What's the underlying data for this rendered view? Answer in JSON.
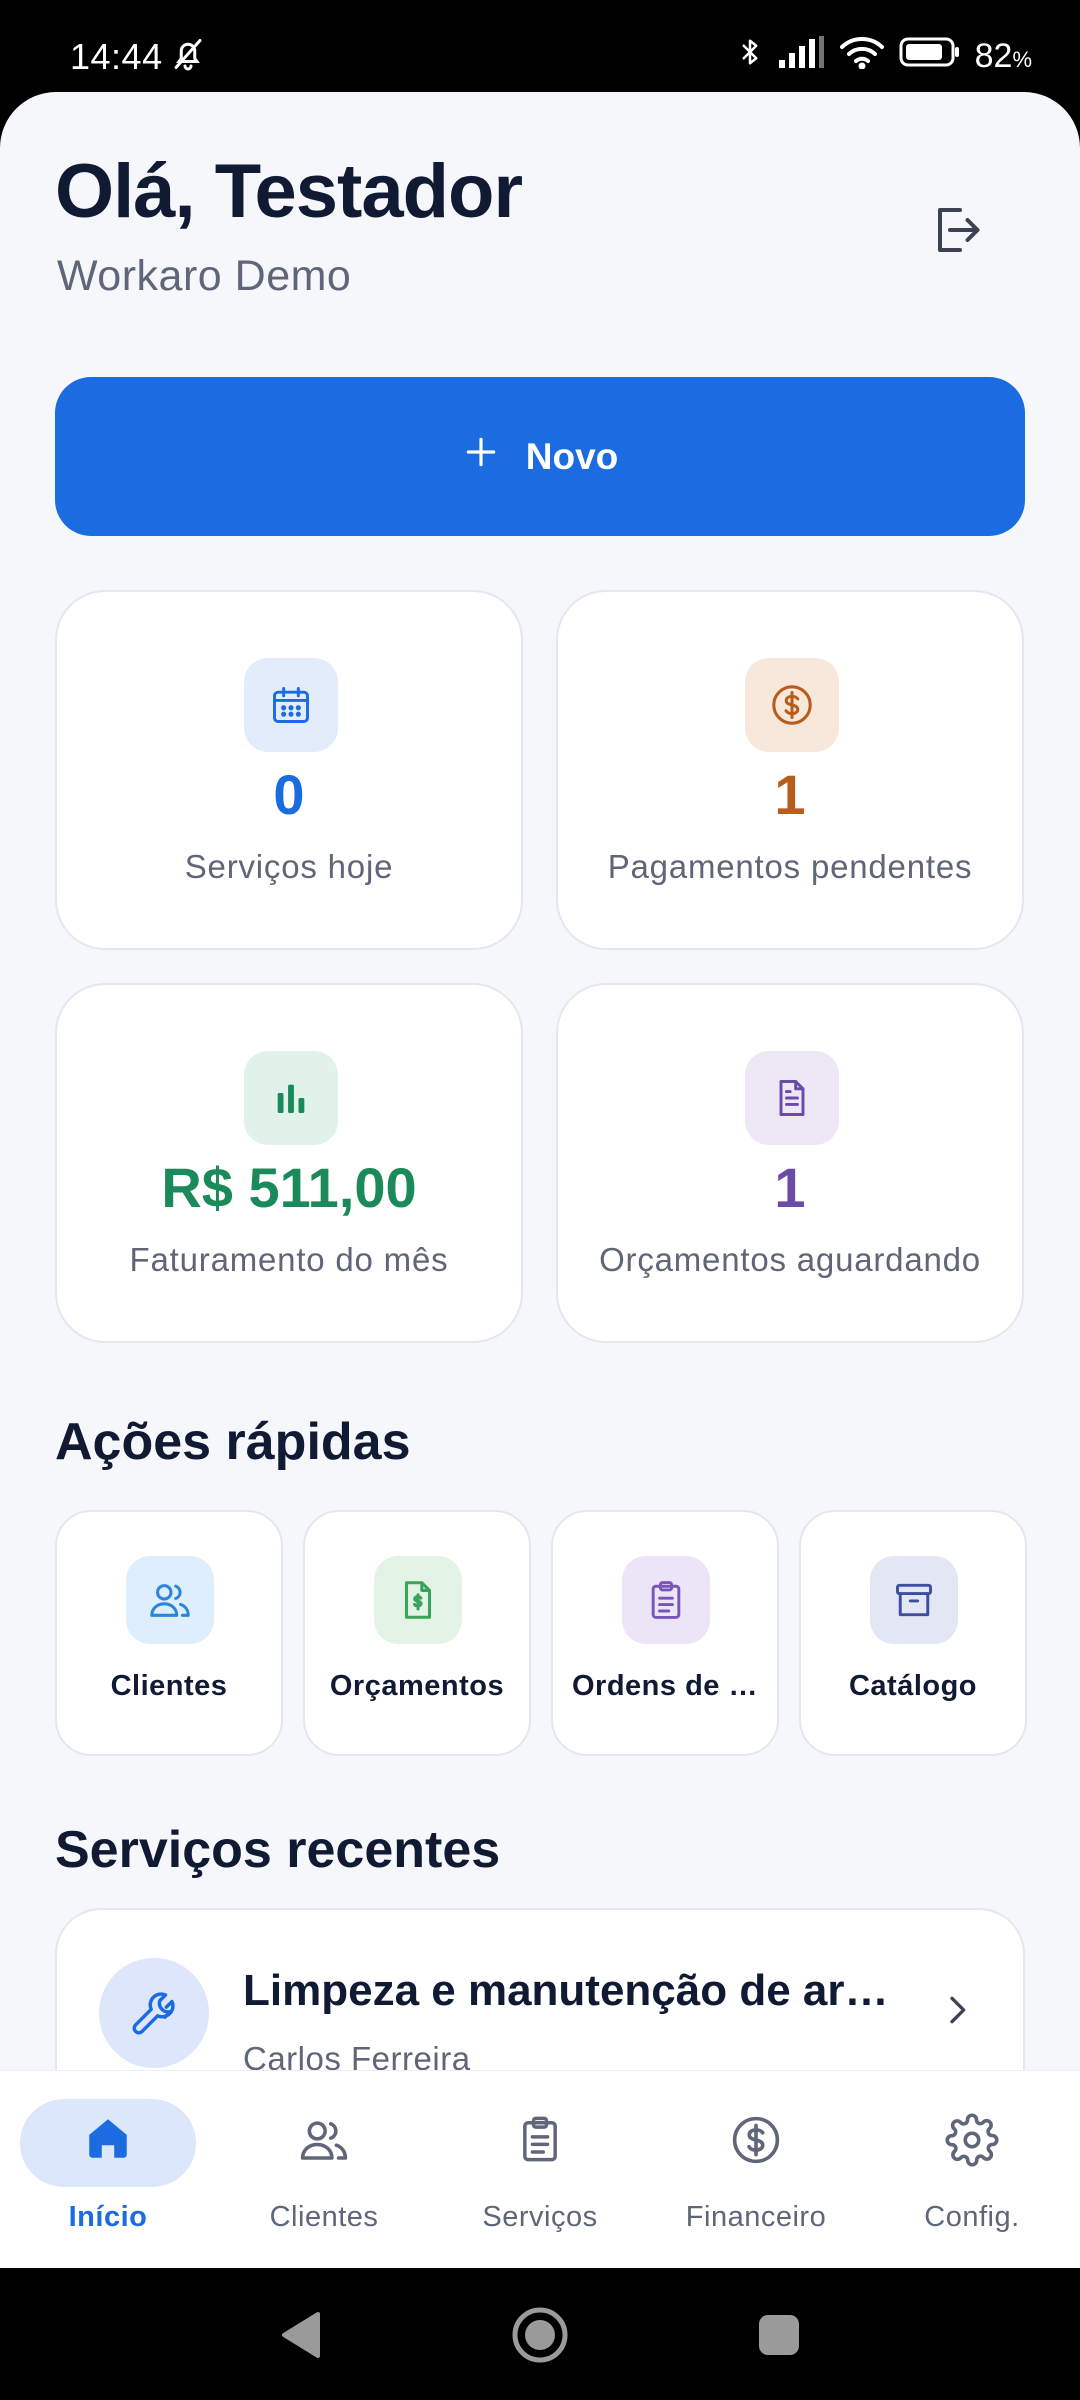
{
  "status_bar": {
    "time": "14:44",
    "battery": "82"
  },
  "header": {
    "greeting": "Olá, Testador",
    "company": "Workaro Demo"
  },
  "new_button": {
    "label": "Novo"
  },
  "stats": [
    {
      "value": "0",
      "label": "Serviços hoje",
      "color": "#1a6ce0",
      "icon": "calendar-icon"
    },
    {
      "value": "1",
      "label": "Pagamentos pendentes",
      "color": "#b85d1c",
      "icon": "dollar-icon"
    },
    {
      "value": "R$ 511,00",
      "label": "Faturamento do mês",
      "color": "#1b8a5a",
      "icon": "bar-chart-icon"
    },
    {
      "value": "1",
      "label": "Orçamentos aguardando",
      "color": "#6b4ba8",
      "icon": "document-icon"
    }
  ],
  "quick_actions": {
    "title": "Ações rápidas",
    "items": [
      {
        "label": "Clientes",
        "icon": "users-icon"
      },
      {
        "label": "Orçamentos",
        "icon": "invoice-icon"
      },
      {
        "label": "Ordens de …",
        "icon": "clipboard-icon"
      },
      {
        "label": "Catálogo",
        "icon": "archive-icon"
      }
    ]
  },
  "recent_services": {
    "title": "Serviços recentes",
    "items": [
      {
        "title": "Limpeza e manutenção de ar-c...",
        "client": "Carlos Ferreira",
        "icon": "wrench-icon"
      }
    ]
  },
  "bottom_nav": {
    "active_color": "#1a6ce0",
    "items": [
      {
        "label": "Início",
        "icon": "home-icon",
        "active": true
      },
      {
        "label": "Clientes",
        "icon": "users-icon",
        "active": false
      },
      {
        "label": "Serviços",
        "icon": "clipboard-icon",
        "active": false
      },
      {
        "label": "Financeiro",
        "icon": "dollar-icon",
        "active": false
      },
      {
        "label": "Config.",
        "icon": "gear-icon",
        "active": false
      }
    ]
  }
}
